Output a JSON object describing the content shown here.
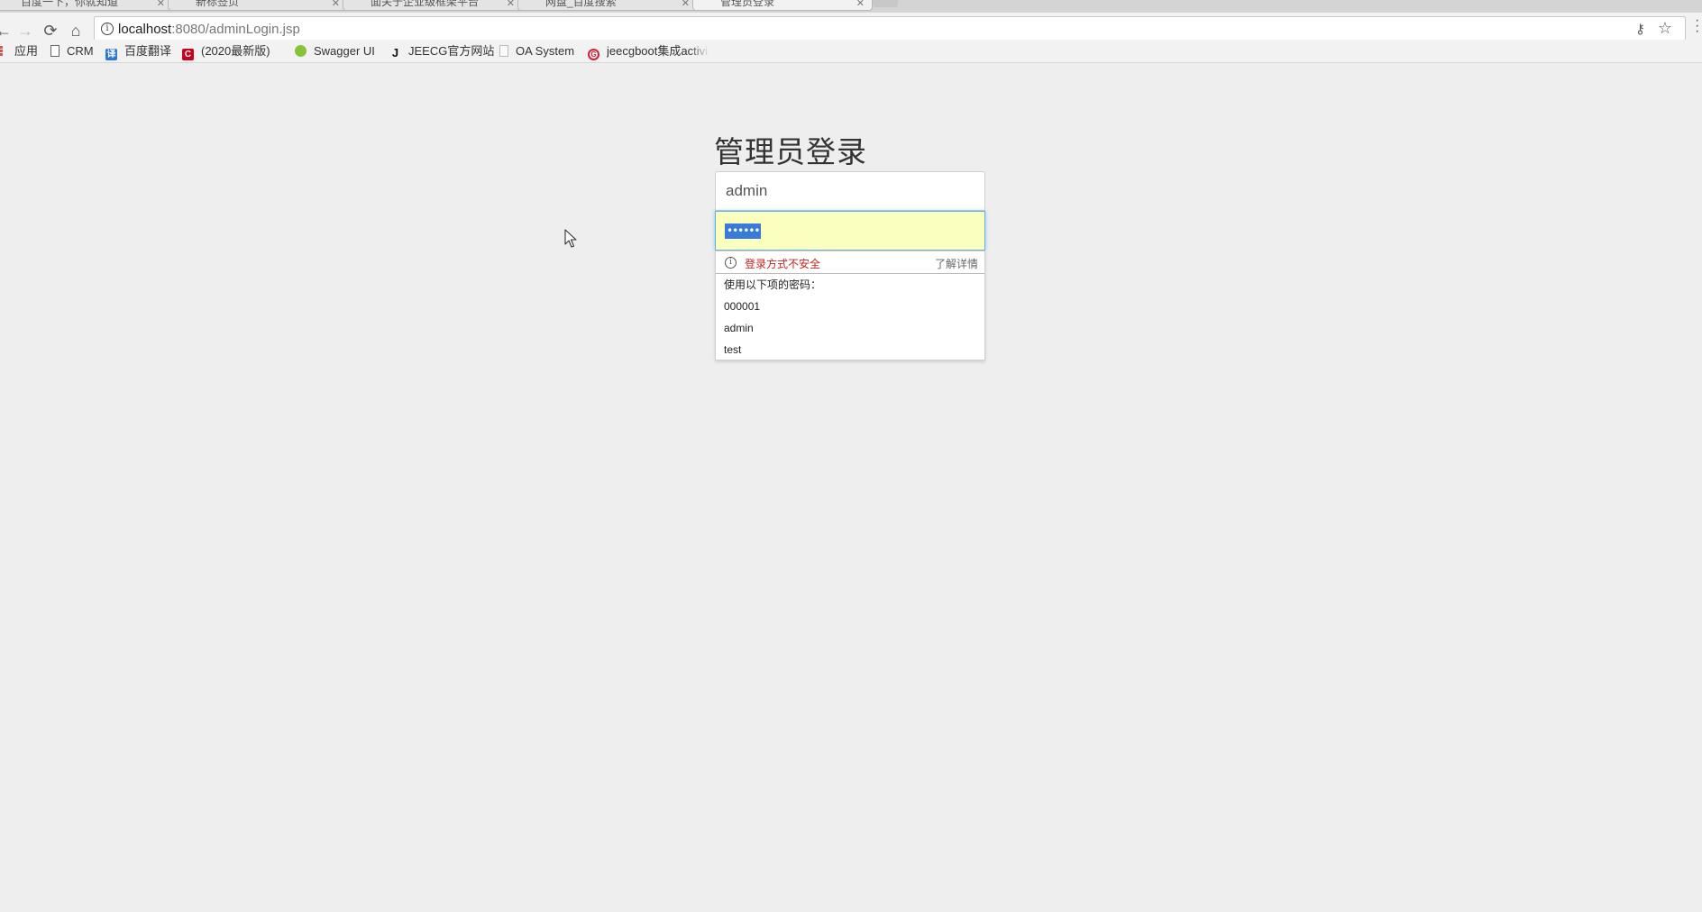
{
  "browser": {
    "tabs": [
      {
        "label": "百度一下，你就知道"
      },
      {
        "label": "新标签页"
      },
      {
        "label": "面关于企业级框架平台"
      },
      {
        "label": "网盘_百度搜索"
      },
      {
        "label": "管理员登录"
      }
    ],
    "url": {
      "host": "localhost",
      "path": ":8080/adminLogin.jsp"
    }
  },
  "bookmarks": [
    {
      "label": "应用",
      "icon": "apps-grid-icon"
    },
    {
      "label": "CRM",
      "icon": "document-icon"
    },
    {
      "label": "百度翻译",
      "icon": "baidu-translate-icon"
    },
    {
      "label": "(2020最新版)",
      "icon": "c-logo-icon"
    },
    {
      "label": "Swagger UI",
      "icon": "swagger-icon"
    },
    {
      "label": "JEECG官方网站",
      "icon": "jeecg-j-icon"
    },
    {
      "label": "OA System",
      "icon": "document-icon"
    },
    {
      "label": "jeecgboot集成activi",
      "icon": "jeecg-g-icon"
    }
  ],
  "login": {
    "title": "管理员登录",
    "username": "admin",
    "password_mask": "••••••"
  },
  "autofill": {
    "warning": "登录方式不安全",
    "learn_more": "了解详情",
    "header": "使用以下项的密码：",
    "items": [
      "000001",
      "admin",
      "test"
    ]
  },
  "colors": {
    "page_bg": "#eeeeee",
    "autofill_bg": "#faffbd",
    "focus_border": "#66afe9",
    "warning_text": "#c5221f",
    "selection": "#3a7ad9"
  }
}
